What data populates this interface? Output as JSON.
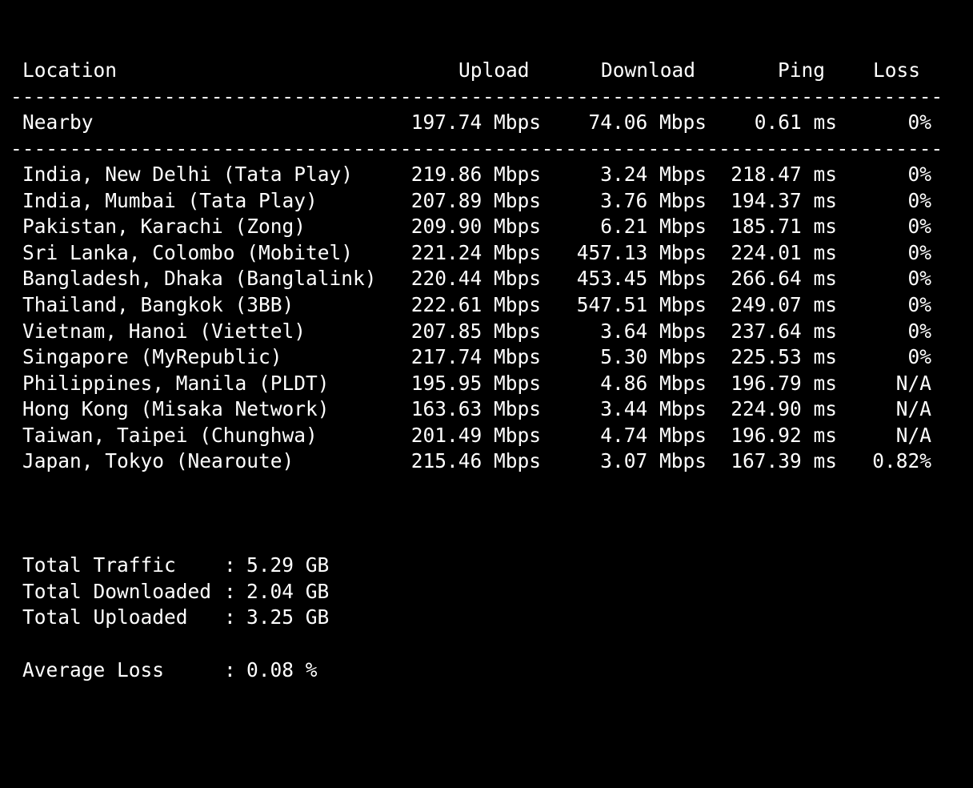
{
  "header": {
    "location": "Location",
    "upload": "Upload",
    "download": "Download",
    "ping": "Ping",
    "loss": "Loss"
  },
  "separator": "-----------------------------------------------------------------------------------",
  "nearby": {
    "location": "Nearby",
    "upload": "197.74 Mbps",
    "download": "74.06 Mbps",
    "ping": "0.61 ms",
    "loss": "0%"
  },
  "rows": [
    {
      "location": "India, New Delhi (Tata Play)",
      "upload": "219.86 Mbps",
      "download": "3.24 Mbps",
      "ping": "218.47 ms",
      "loss": "0%"
    },
    {
      "location": "India, Mumbai (Tata Play)",
      "upload": "207.89 Mbps",
      "download": "3.76 Mbps",
      "ping": "194.37 ms",
      "loss": "0%"
    },
    {
      "location": "Pakistan, Karachi (Zong)",
      "upload": "209.90 Mbps",
      "download": "6.21 Mbps",
      "ping": "185.71 ms",
      "loss": "0%"
    },
    {
      "location": "Sri Lanka, Colombo (Mobitel)",
      "upload": "221.24 Mbps",
      "download": "457.13 Mbps",
      "ping": "224.01 ms",
      "loss": "0%"
    },
    {
      "location": "Bangladesh, Dhaka (Banglalink)",
      "upload": "220.44 Mbps",
      "download": "453.45 Mbps",
      "ping": "266.64 ms",
      "loss": "0%"
    },
    {
      "location": "Thailand, Bangkok (3BB)",
      "upload": "222.61 Mbps",
      "download": "547.51 Mbps",
      "ping": "249.07 ms",
      "loss": "0%"
    },
    {
      "location": "Vietnam, Hanoi (Viettel)",
      "upload": "207.85 Mbps",
      "download": "3.64 Mbps",
      "ping": "237.64 ms",
      "loss": "0%"
    },
    {
      "location": "Singapore (MyRepublic)",
      "upload": "217.74 Mbps",
      "download": "5.30 Mbps",
      "ping": "225.53 ms",
      "loss": "0%"
    },
    {
      "location": "Philippines, Manila (PLDT)",
      "upload": "195.95 Mbps",
      "download": "4.86 Mbps",
      "ping": "196.79 ms",
      "loss": "N/A"
    },
    {
      "location": "Hong Kong (Misaka Network)",
      "upload": "163.63 Mbps",
      "download": "3.44 Mbps",
      "ping": "224.90 ms",
      "loss": "N/A"
    },
    {
      "location": "Taiwan, Taipei (Chunghwa)",
      "upload": "201.49 Mbps",
      "download": "4.74 Mbps",
      "ping": "196.92 ms",
      "loss": "N/A"
    },
    {
      "location": "Japan, Tokyo (Nearoute)",
      "upload": "215.46 Mbps",
      "download": "3.07 Mbps",
      "ping": "167.39 ms",
      "loss": "0.82%"
    }
  ],
  "summary": {
    "total_traffic": {
      "label": "Total Traffic",
      "colon": ":",
      "value": "5.29 GB"
    },
    "total_downloaded": {
      "label": "Total Downloaded",
      "colon": ":",
      "value": "2.04 GB"
    },
    "total_uploaded": {
      "label": "Total Uploaded",
      "colon": ":",
      "value": "3.25 GB"
    },
    "average_loss": {
      "label": "Average Loss",
      "colon": ":",
      "value": "0.08 %"
    }
  }
}
